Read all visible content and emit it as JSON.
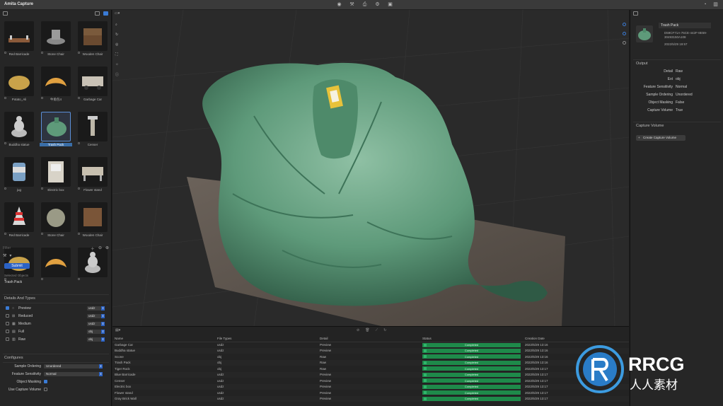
{
  "app": {
    "title": "Amita Capture"
  },
  "objects": [
    {
      "label": "Red Barricade",
      "shape": "barricade"
    },
    {
      "label": "Stone Chair",
      "shape": "chair"
    },
    {
      "label": "Wooden Chair",
      "shape": "wood"
    },
    {
      "label": "Potato_Ali",
      "shape": "potato"
    },
    {
      "label": "牛角包4",
      "shape": "croissant"
    },
    {
      "label": "Garbage Car",
      "shape": "car"
    },
    {
      "label": "Buddha statue",
      "shape": "buddha"
    },
    {
      "label": "Trash Pack",
      "shape": "bag",
      "selected": true
    },
    {
      "label": "Censer",
      "shape": "censer"
    },
    {
      "label": "jug",
      "shape": "jug"
    },
    {
      "label": "Electric box",
      "shape": "box"
    },
    {
      "label": "Flower stand",
      "shape": "stand"
    },
    {
      "label": "Red Barricade",
      "shape": "cone"
    },
    {
      "label": "Stone Chair",
      "shape": "stone"
    },
    {
      "label": "Wooden Chair",
      "shape": "woodchair"
    },
    {
      "label": "",
      "shape": "potato"
    },
    {
      "label": "",
      "shape": "croissant"
    },
    {
      "label": "",
      "shape": "buddha"
    }
  ],
  "left": {
    "search_placeholder": "Filter",
    "submit_label": "Submit",
    "selected_objects_label": "Selected Objects",
    "selected_object": "Trash Pack",
    "details_title": "Details And Types",
    "detail_rows": [
      {
        "name": "Preview",
        "value": "usdz",
        "checked": true,
        "icon": "○"
      },
      {
        "name": "Reduced",
        "value": "usdz",
        "checked": false,
        "icon": "⊞"
      },
      {
        "name": "Medium",
        "value": "usdz",
        "checked": false,
        "icon": "▦"
      },
      {
        "name": "Full",
        "value": "obj",
        "checked": false,
        "icon": "▤"
      },
      {
        "name": "Raw",
        "value": "obj",
        "checked": false,
        "icon": "▥"
      }
    ],
    "config_title": "Configures",
    "sample_ordering_label": "Sample Ordering",
    "sample_ordering_value": "Unordered",
    "feature_sensitivity_label": "Feature Sensitivity",
    "feature_sensitivity_value": "Normal",
    "object_masking_label": "Object Masking",
    "use_capture_volume_label": "Use Capture Volume"
  },
  "table": {
    "headers": [
      "Name",
      "File Types",
      "Detail",
      "Status",
      "Creation Date"
    ],
    "rows": [
      {
        "name": "Garbage Car",
        "type": "usdz",
        "detail": "Preview",
        "status": "Completed",
        "date": "2022/5/29 13:16"
      },
      {
        "name": "Buddha statue",
        "type": "usdz",
        "detail": "Preview",
        "status": "Completed",
        "date": "2022/5/29 13:16"
      },
      {
        "name": "Scone",
        "type": "obj",
        "detail": "Raw",
        "status": "Completed",
        "date": "2022/5/29 13:16"
      },
      {
        "name": "Trash Pack",
        "type": "obj",
        "detail": "Raw",
        "status": "Completed",
        "date": "2022/5/29 13:16"
      },
      {
        "name": "Tiger Rock",
        "type": "obj",
        "detail": "Raw",
        "status": "Completed",
        "date": "2022/5/29 13:17"
      },
      {
        "name": "Blue Barricade",
        "type": "usdz",
        "detail": "Preview",
        "status": "Completed",
        "date": "2022/5/29 13:17"
      },
      {
        "name": "Censer",
        "type": "usdz",
        "detail": "Preview",
        "status": "Completed",
        "date": "2022/5/29 13:17"
      },
      {
        "name": "Electric box",
        "type": "usdz",
        "detail": "Preview",
        "status": "Completed",
        "date": "2022/5/29 13:17"
      },
      {
        "name": "Flower stand",
        "type": "usdz",
        "detail": "Preview",
        "status": "Completed",
        "date": "2022/5/29 13:17"
      },
      {
        "name": "Gray Brick Wall",
        "type": "usdz",
        "detail": "Preview",
        "status": "Completed",
        "date": "2022/5/29 13:17"
      }
    ]
  },
  "right": {
    "name": "Trash Pack",
    "uuid": "D59CF71A-76CE-442F-8E59-30493150A108",
    "date": "2022/5/29 19:57",
    "output_title": "Output",
    "output": [
      {
        "k": "Detail",
        "v": "Raw"
      },
      {
        "k": "Ext",
        "v": "obj"
      },
      {
        "k": "Feature Sensitivity",
        "v": "Normal"
      },
      {
        "k": "Sample Ordering",
        "v": "Unordered"
      },
      {
        "k": "Object Masking",
        "v": "False"
      },
      {
        "k": "Capture Volume",
        "v": "True"
      }
    ],
    "capture_volume_title": "Capture Volume",
    "create_capture_volume_label": "Create Capture Volume"
  },
  "watermark": {
    "brand": "RRCG",
    "sub": "人人素材"
  },
  "colors": {
    "accent": "#2b62c4",
    "status_green": "#1e8a4a",
    "bag_green": "#5e9a7a"
  }
}
